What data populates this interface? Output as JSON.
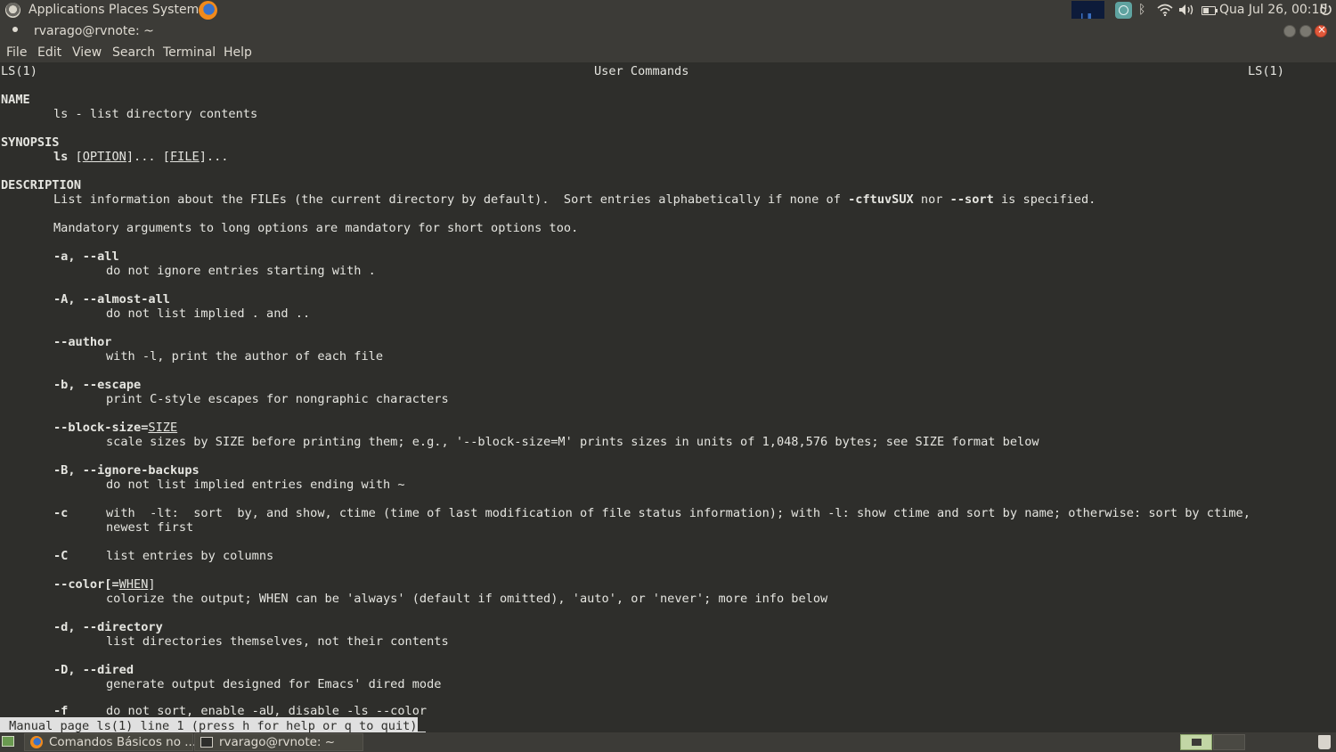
{
  "top_panel": {
    "applications": "Applications",
    "places": "Places",
    "system": "System",
    "clock": "Qua Jul 26, 00:15"
  },
  "window": {
    "title": "rvarago@rvnote: ~"
  },
  "menu_bar": {
    "file": "File",
    "edit": "Edit",
    "view": "View",
    "search": "Search",
    "terminal": "Terminal",
    "help": "Help"
  },
  "man": {
    "header_left": "LS(1)",
    "header_center": "User Commands",
    "header_right": "LS(1)",
    "name_heading": "NAME",
    "name_text": "ls - list directory contents",
    "synopsis_heading": "SYNOPSIS",
    "synopsis_cmd": "ls",
    "synopsis_option": "OPTION",
    "synopsis_file": "FILE",
    "description_heading": "DESCRIPTION",
    "desc_line1_a": "List information about the FILEs (the current directory by default).  Sort entries alphabetically if none of ",
    "desc_line1_b": "-cftuvSUX",
    "desc_line1_c": " nor ",
    "desc_line1_d": "--sort",
    "desc_line1_e": " is specified.",
    "desc_line2": "Mandatory arguments to long options are mandatory for short options too.",
    "opt_a": "-a, --all",
    "opt_a_desc": "do not ignore entries starting with .",
    "opt_A": "-A, --almost-all",
    "opt_A_desc": "do not list implied . and ..",
    "opt_author": "--author",
    "opt_author_desc": "with -l, print the author of each file",
    "opt_b": "-b, --escape",
    "opt_b_desc": "print C-style escapes for nongraphic characters",
    "opt_block": "--block-size=",
    "opt_block_arg": "SIZE",
    "opt_block_desc": "scale sizes by SIZE before printing them; e.g., '--block-size=M' prints sizes in units of 1,048,576 bytes; see SIZE format below",
    "opt_B": "-B, --ignore-backups",
    "opt_B_desc": "do not list implied entries ending with ~",
    "opt_c": "-c",
    "opt_c_desc": "with  -lt:  sort  by, and show, ctime (time of last modification of file status information); with -l: show ctime and sort by name; otherwise: sort by ctime,",
    "opt_c_desc2": "newest first",
    "opt_C": "-C",
    "opt_C_desc": "list entries by columns",
    "opt_color": "--color[=",
    "opt_color_arg": "WHEN",
    "opt_color_end": "]",
    "opt_color_desc": "colorize the output; WHEN can be 'always' (default if omitted), 'auto', or 'never'; more info below",
    "opt_d": "-d, --directory",
    "opt_d_desc": "list directories themselves, not their contents",
    "opt_D": "-D, --dired",
    "opt_D_desc": "generate output designed for Emacs' dired mode",
    "opt_f": "-f",
    "opt_f_desc": "do not sort, enable -aU, disable -ls --color"
  },
  "status_line": " Manual page ls(1) line 1 (press h for help or q to quit)",
  "bottom_panel": {
    "task_firefox": "Comandos Básicos no ...",
    "task_terminal": "rvarago@rvnote: ~"
  }
}
